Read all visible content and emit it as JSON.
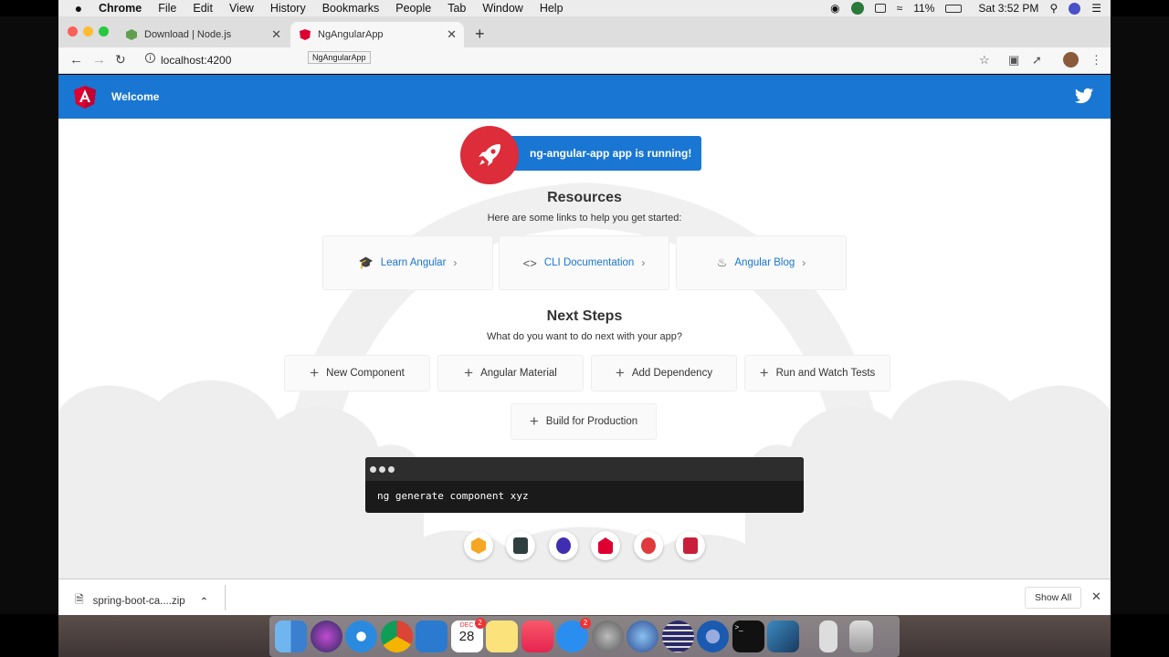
{
  "menubar": {
    "apple": "",
    "items": [
      "Chrome",
      "File",
      "Edit",
      "View",
      "History",
      "Bookmarks",
      "People",
      "Tab",
      "Window",
      "Help"
    ],
    "battery": "11%",
    "clock": "Sat 3:52 PM"
  },
  "tabs": [
    {
      "title": "Download | Node.js",
      "active": false
    },
    {
      "title": "NgAngularApp",
      "active": true
    }
  ],
  "toolbar": {
    "url": "localhost:4200",
    "tooltip": "NgAngularApp"
  },
  "app": {
    "header_title": "Welcome",
    "running_text": "ng-angular-app app is running!",
    "resources_title": "Resources",
    "resources_sub": "Here are some links to help you get started:",
    "resource_links": [
      {
        "label": "Learn Angular",
        "icon": "graduation-cap-icon"
      },
      {
        "label": "CLI Documentation",
        "icon": "code-icon"
      },
      {
        "label": "Angular Blog",
        "icon": "flame-icon"
      }
    ],
    "next_title": "Next Steps",
    "next_sub": "What do you want to do next with your app?",
    "steps": [
      "New Component",
      "Angular Material",
      "Add Dependency",
      "Run and Watch Tests",
      "Build for Production"
    ],
    "terminal_command": "ng generate component xyz",
    "partner_icons": [
      "angular-console-icon",
      "augury-icon",
      "nrwl-icon",
      "angular-icon",
      "meetup-icon",
      "discord-icon"
    ]
  },
  "download": {
    "file_name": "spring-boot-ca....zip",
    "show_all": "Show All"
  },
  "dock": {
    "calendar_month": "DEC",
    "calendar_day": "28",
    "calendar_badge": "2",
    "appstore_badge": "2"
  },
  "colors": {
    "angular_blue": "#1976d2",
    "angular_red": "#dd2c3a"
  }
}
